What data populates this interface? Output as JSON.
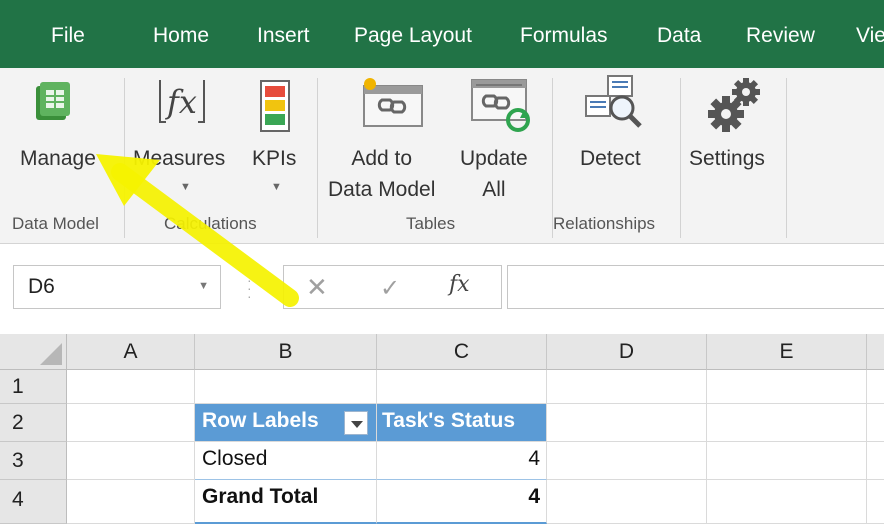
{
  "menu": {
    "tabs": [
      "File",
      "Home",
      "Insert",
      "Page Layout",
      "Formulas",
      "Data",
      "Review",
      "Vie"
    ]
  },
  "ribbon": {
    "data_model_group": {
      "label": "Data Model",
      "manage": "Manage"
    },
    "calculations_group": {
      "label": "Calculations",
      "measures": "Measures",
      "kpis": "KPIs"
    },
    "tables_group": {
      "label": "Tables",
      "add_line1": "Add to",
      "add_line2": "Data Model",
      "update_line1": "Update",
      "update_line2": "All"
    },
    "relationships_group": {
      "label": "Relationships",
      "detect": "Detect"
    },
    "settings": "Settings"
  },
  "formula_bar": {
    "name_box": "D6",
    "cancel_icon": "close-icon",
    "enter_icon": "check-icon",
    "fx_label": "fx",
    "value": ""
  },
  "sheet": {
    "columns": [
      "A",
      "B",
      "C",
      "D",
      "E"
    ],
    "rows": [
      "1",
      "2",
      "3",
      "4"
    ],
    "pivot": {
      "header_row_labels": "Row Labels",
      "header_value": "Task's Status",
      "row_label": "Closed",
      "row_value": "4",
      "total_label": "Grand Total",
      "total_value": "4"
    }
  },
  "colors": {
    "menu_bg": "#217346",
    "ribbon_bg": "#f3f3f3",
    "pivot_header": "#5b9bd5",
    "annotation_arrow": "#f6f200"
  }
}
